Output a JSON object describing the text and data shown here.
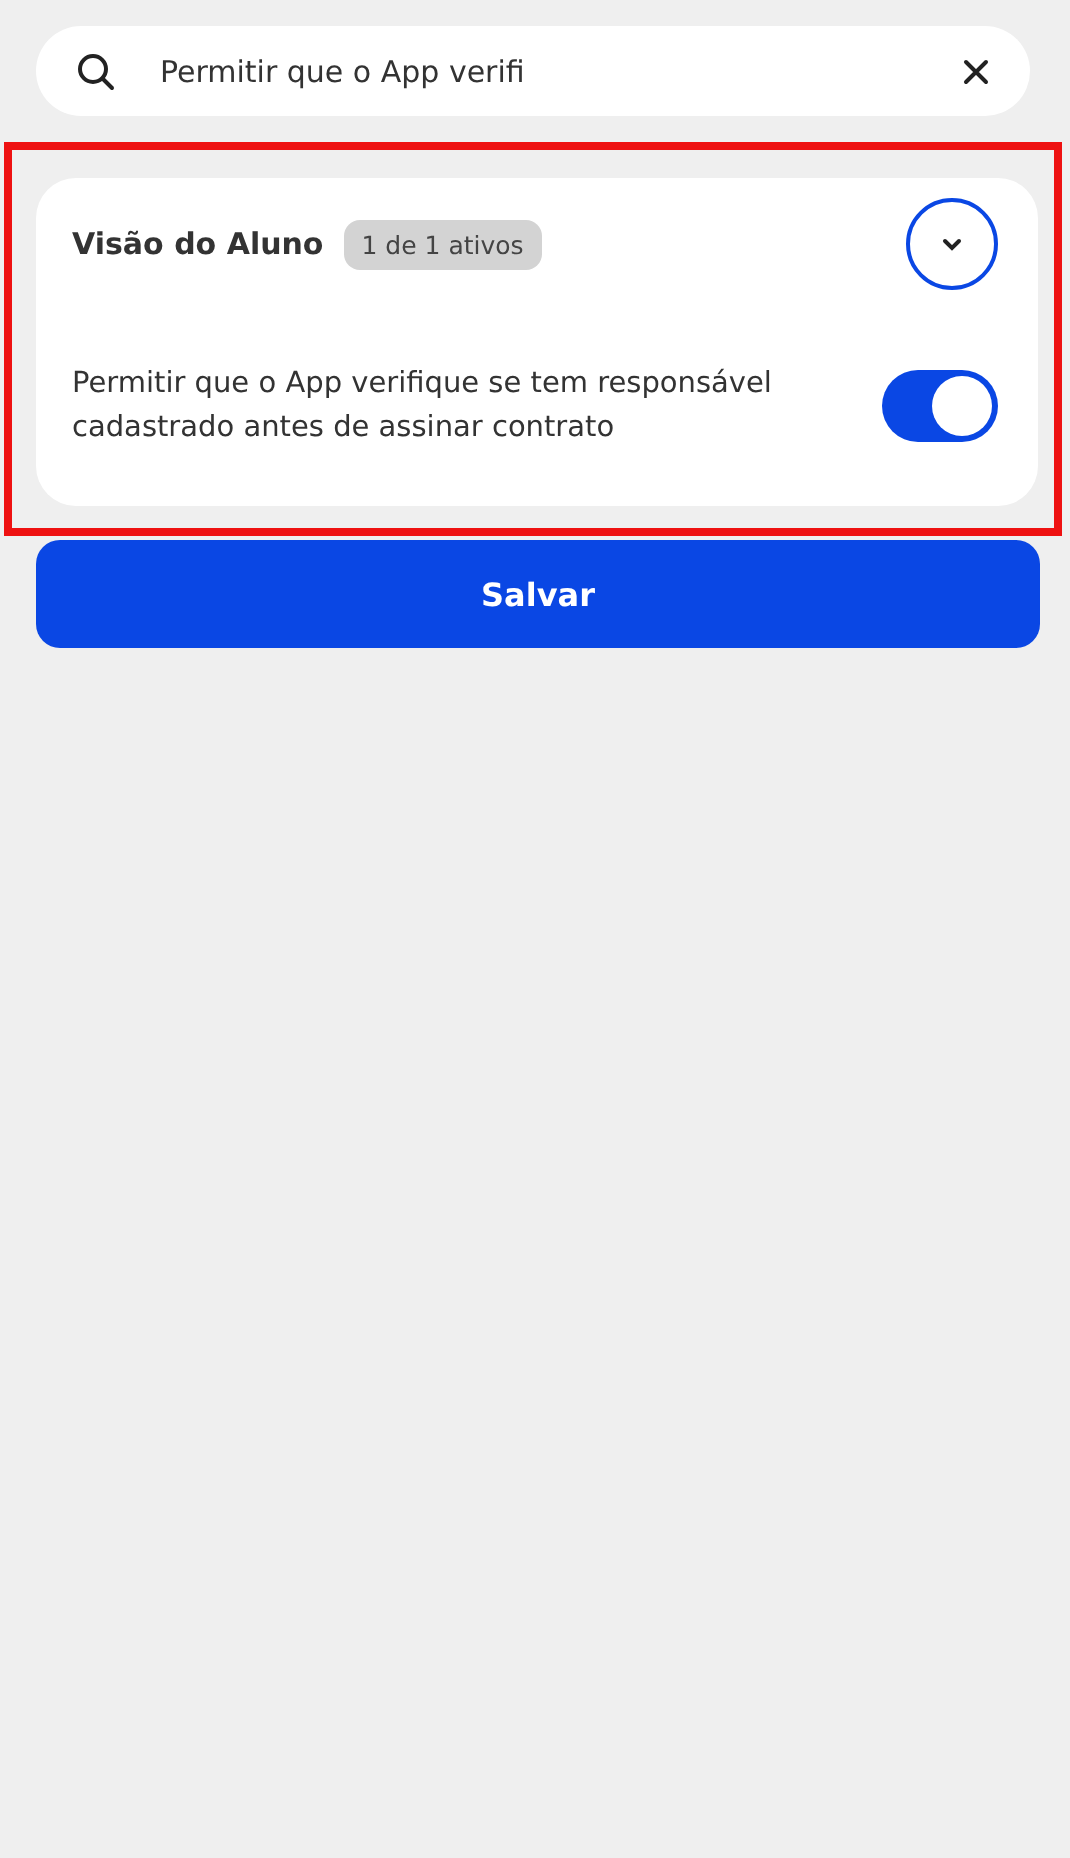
{
  "search": {
    "value": "Permitir que o App verifi"
  },
  "section": {
    "title": "Visão do Aluno",
    "badge": "1 de 1 ativos",
    "highlighted": true,
    "settings": [
      {
        "label": "Permitir que o App verifique se tem responsável cadastrado antes de assinar contrato",
        "on": true
      }
    ]
  },
  "save_button": "Salvar"
}
